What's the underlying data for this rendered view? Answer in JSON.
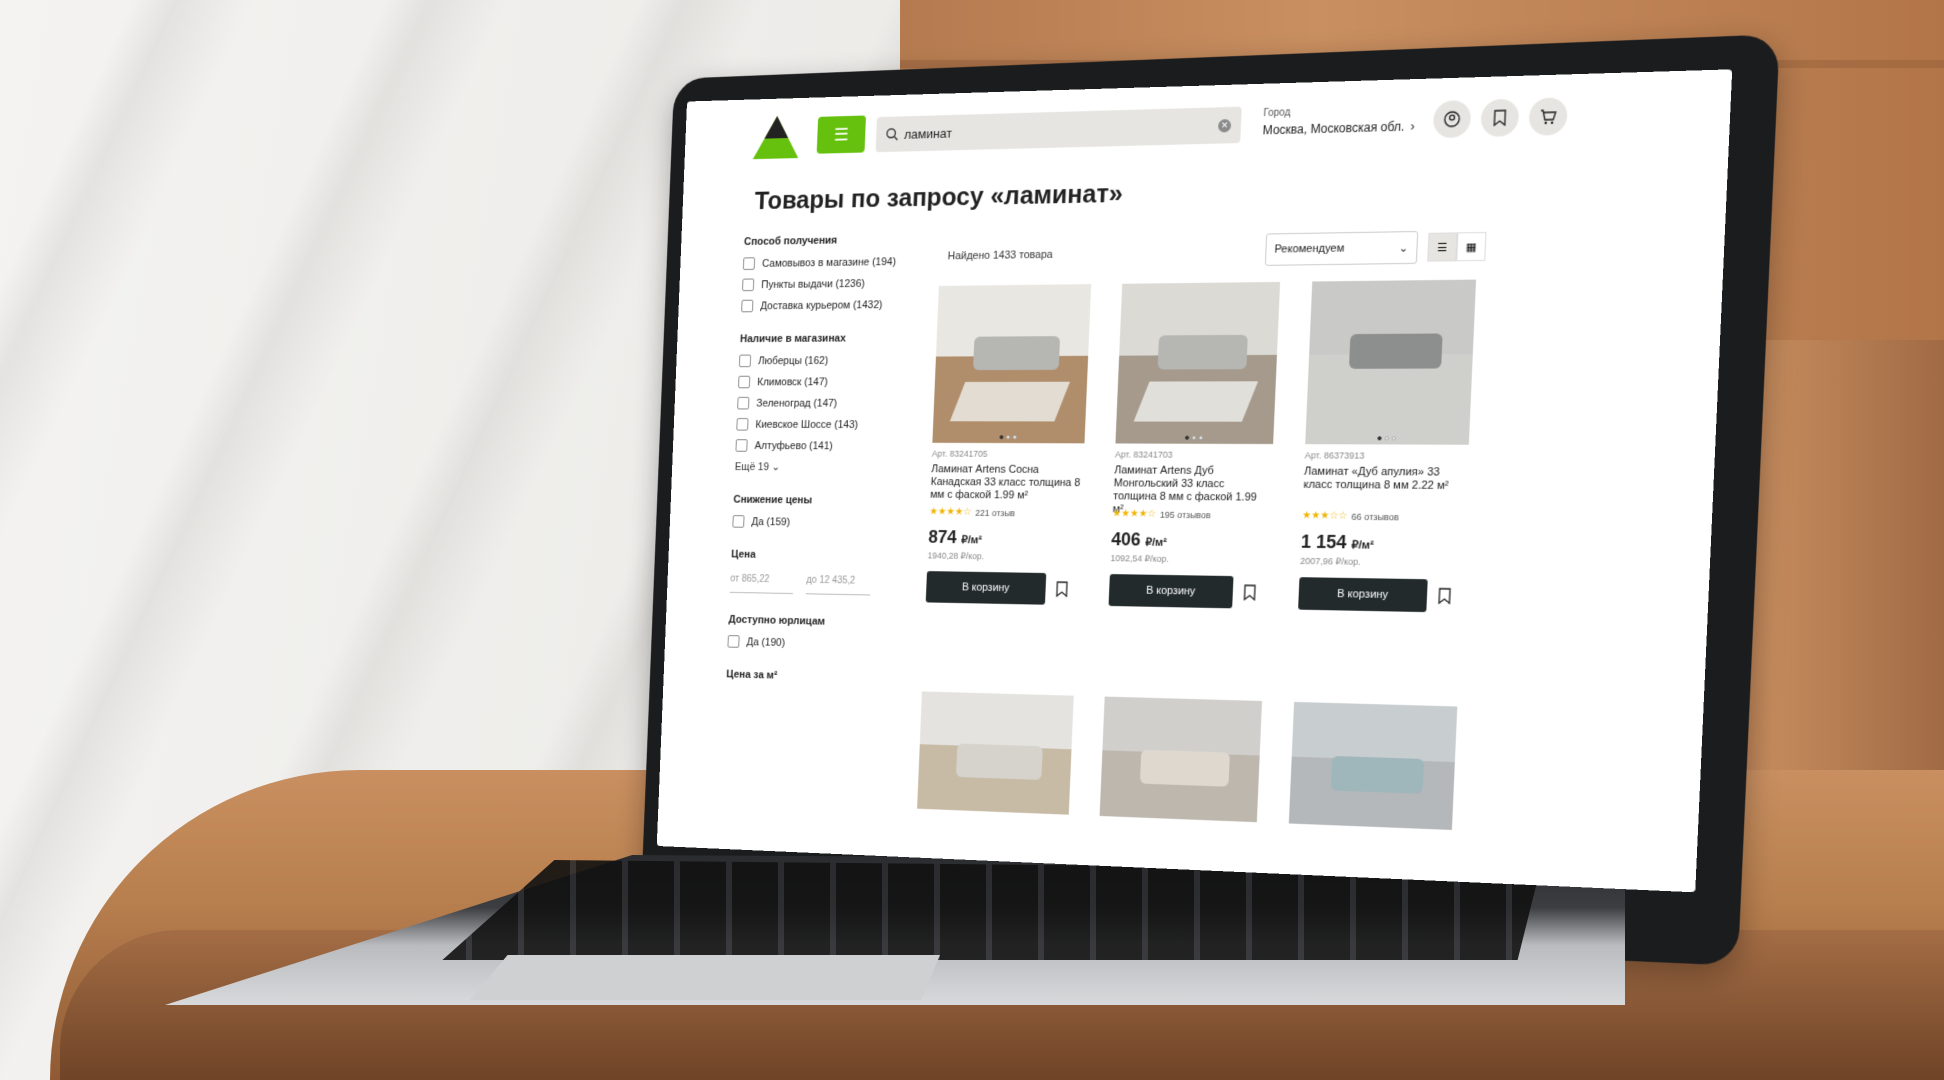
{
  "header": {
    "logo_text": "LEROY MERLIN",
    "menu_icon": "hamburger-icon",
    "search_value": "ламинат",
    "city_label": "Город",
    "city_value": "Москва, Московская обл.",
    "icons": [
      "user-icon",
      "bookmark-icon",
      "cart-icon"
    ]
  },
  "page_title": "Товары по запросу «ламинат»",
  "filters": {
    "delivery": {
      "heading": "Способ получения",
      "options": [
        "Самовывоз в магазине (194)",
        "Пункты выдачи (1236)",
        "Доставка курьером (1432)"
      ]
    },
    "stores": {
      "heading": "Наличие в магазинах",
      "options": [
        "Люберцы (162)",
        "Климовск (147)",
        "Зеленоград (147)",
        "Киевское Шоссе (143)",
        "Алтуфьево (141)"
      ],
      "more": "Ещё 19"
    },
    "discount": {
      "heading": "Снижение цены",
      "options": [
        "Да (159)"
      ]
    },
    "price": {
      "heading": "Цена",
      "from": "от 865,22",
      "to": "до 12 435,2"
    },
    "legal": {
      "heading": "Доступно юрлицам",
      "options": [
        "Да (190)"
      ]
    },
    "per_m2": {
      "heading": "Цена за м²"
    }
  },
  "results": {
    "found": "Найдено 1433 товара",
    "sort": "Рекомендуем"
  },
  "products": [
    {
      "art": "Арт. 83241705",
      "name": "Ламинат Artens Сосна Канадская 33 класс толщина 8 мм с фаской 1.99 м²",
      "stars": "★★★★☆",
      "reviews": "221 отзыв",
      "price": "874",
      "unit": "₽/м²",
      "subprice": "1940,28 ₽/кор.",
      "buy": "В корзину",
      "wall": "#e9e7e2",
      "floor": "#b08e6b"
    },
    {
      "art": "Арт. 83241703",
      "name": "Ламинат Artens Дуб Монгольский 33 класс толщина 8 мм с фаской 1.99 м²",
      "stars": "★★★★☆",
      "reviews": "195 отзывов",
      "price": "406",
      "unit": "₽/м²",
      "subprice": "1092,54 ₽/кор.",
      "buy": "В корзину",
      "wall": "#dcdad5",
      "floor": "#a59a8c"
    },
    {
      "art": "Арт. 86373913",
      "name": "Ламинат «Дуб апулия» 33 класс толщина 8 мм 2.22 м²",
      "stars": "★★★☆☆",
      "reviews": "66 отзывов",
      "price": "1 154",
      "unit": "₽/м²",
      "subprice": "2007,96 ₽/кор.",
      "buy": "В корзину",
      "wall": "#c9c9c7",
      "floor": "#cfcfcc"
    }
  ],
  "colors": {
    "brand_green": "#66c10e",
    "button_dark": "#222a2c",
    "star": "#f0b400"
  }
}
